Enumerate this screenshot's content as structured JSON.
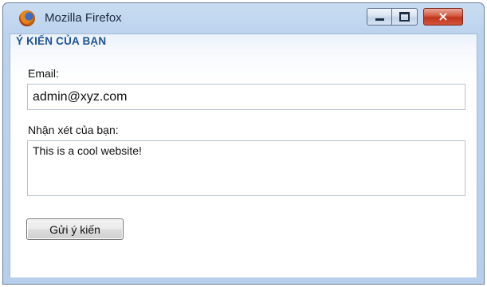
{
  "window": {
    "title": "Mozilla Firefox",
    "icon": "firefox-icon",
    "controls": {
      "minimize": "minimize-icon",
      "maximize": "maximize-icon",
      "close": "×"
    }
  },
  "form": {
    "heading": "Ý KIẾN CỦA BẠN",
    "email_label": "Email:",
    "email_value": "admin@xyz.com",
    "comment_label": "Nhận xét của bạn:",
    "comment_value": "This is a cool website!",
    "submit_label": "Gửi ý kiến"
  },
  "colors": {
    "heading": "#1f5196",
    "close_button": "#c0341c",
    "frame": "#bcd3ee"
  }
}
